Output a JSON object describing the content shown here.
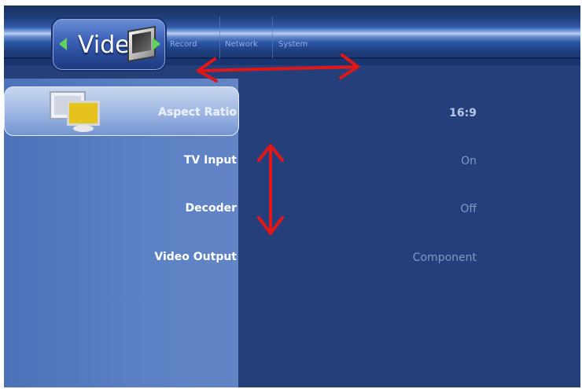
{
  "header": {
    "active_tab": "Video",
    "tabs": [
      "Record",
      "Network",
      "System"
    ]
  },
  "settings": [
    {
      "label": "Aspect Ratio",
      "value": "16:9"
    },
    {
      "label": "TV Input",
      "value": "On"
    },
    {
      "label": "Decoder",
      "value": "Off"
    },
    {
      "label": "Video Output",
      "value": "Component"
    }
  ],
  "colors": {
    "background": "#253f7a",
    "panel": "#5b80c4",
    "highlight": "#a8bfe6",
    "nav_arrow": "#61d35a",
    "annotation": "#e11616"
  },
  "icons": [
    "tv-icon",
    "display-settings-icon",
    "left-arrow-icon",
    "right-arrow-icon"
  ]
}
